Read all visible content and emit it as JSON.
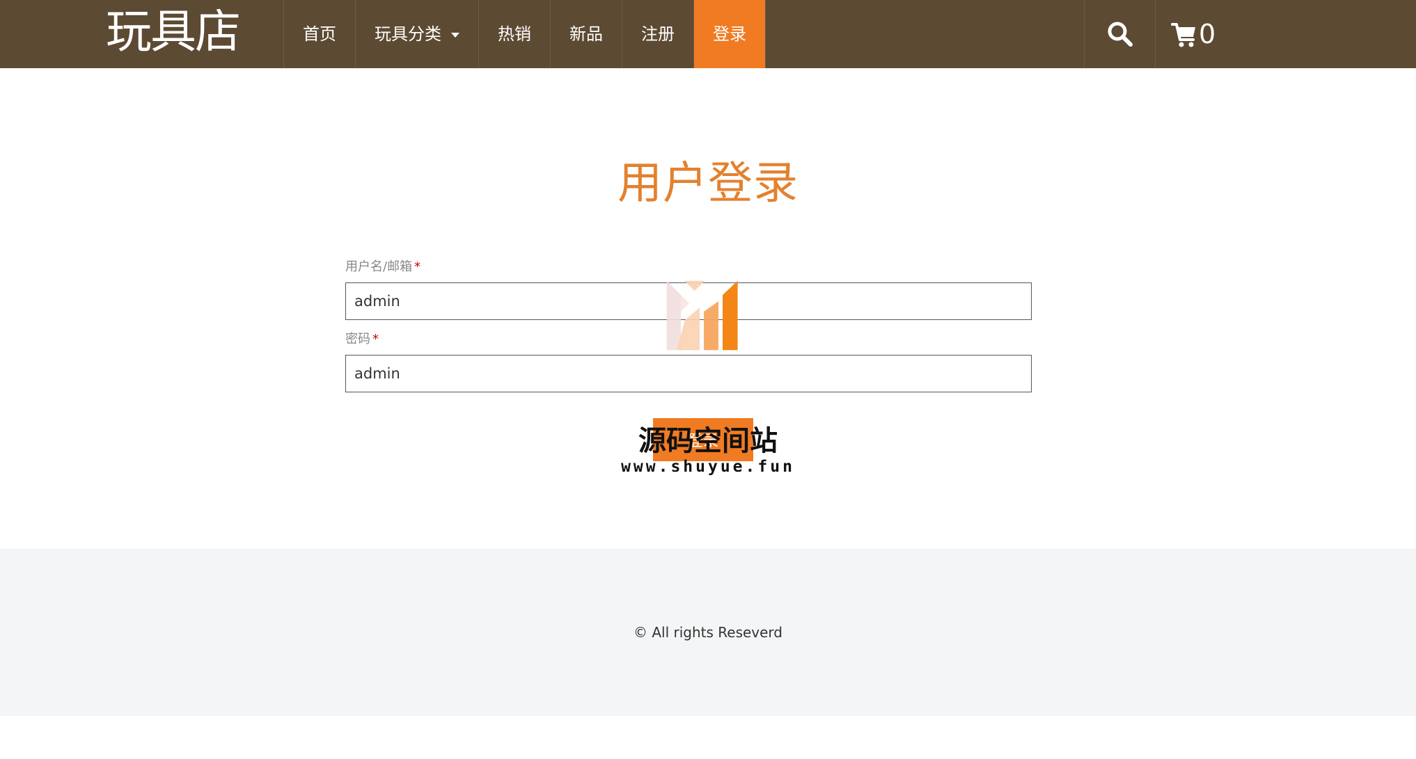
{
  "brand": "玩具店",
  "nav": {
    "home": "首页",
    "categories": "玩具分类",
    "hot": "热销",
    "new": "新品",
    "register": "注册",
    "login": "登录"
  },
  "cart": {
    "count": "0"
  },
  "title": "用户登录",
  "form": {
    "username_label": "用户名/邮箱",
    "username_value": "admin",
    "password_label": "密码",
    "password_value": "admin",
    "required_mark": "*",
    "submit_label": "登录"
  },
  "watermark": {
    "title": "源码空间站",
    "url": "www.shuyue.fun"
  },
  "footer": {
    "copyright": "© All rights Reseverd"
  },
  "colors": {
    "navbar": "#5c4a33",
    "accent": "#f07b22",
    "title": "#e3812e",
    "footer": "#f4f5f6"
  }
}
